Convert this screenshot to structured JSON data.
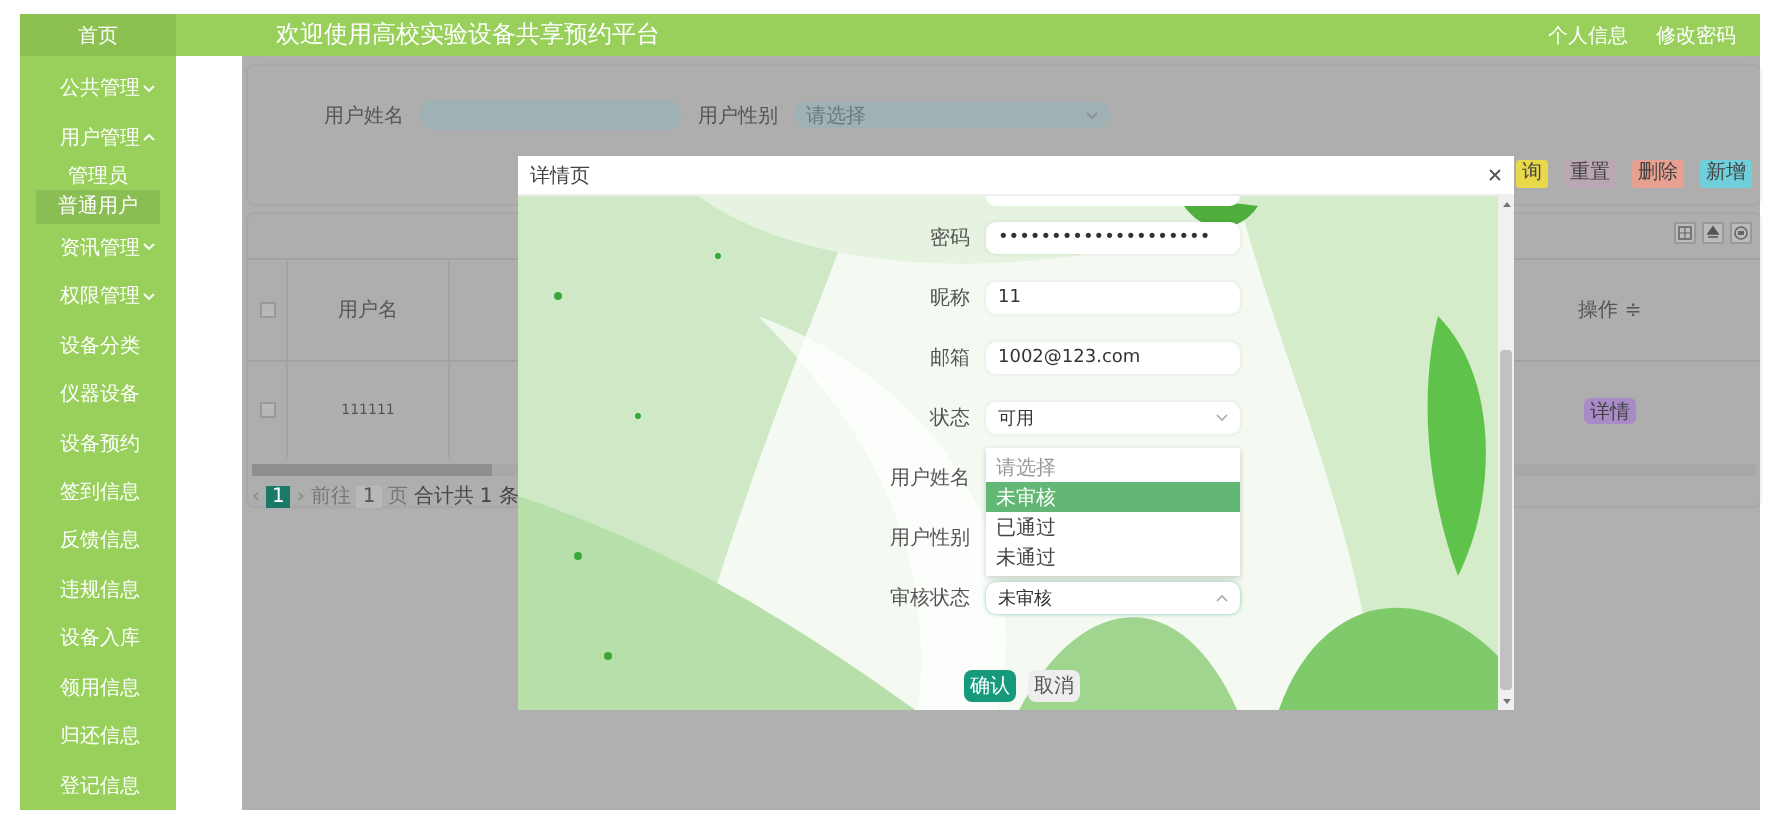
{
  "header": {
    "home": "首页",
    "title": "欢迎使用高校实验设备共享预约平台",
    "links": [
      "个人信息",
      "修改密码"
    ]
  },
  "sidebar": {
    "items": [
      {
        "label": "公共管理",
        "expanded": false
      },
      {
        "label": "用户管理",
        "expanded": true,
        "children": [
          {
            "label": "管理员",
            "selected": false
          },
          {
            "label": "普通用户",
            "selected": true
          }
        ]
      },
      {
        "label": "资讯管理",
        "expanded": false
      },
      {
        "label": "权限管理",
        "expanded": false
      },
      {
        "label": "设备分类"
      },
      {
        "label": "仪器设备"
      },
      {
        "label": "设备预约"
      },
      {
        "label": "签到信息"
      },
      {
        "label": "反馈信息"
      },
      {
        "label": "违规信息"
      },
      {
        "label": "设备入库"
      },
      {
        "label": "领用信息"
      },
      {
        "label": "归还信息"
      },
      {
        "label": "登记信息"
      }
    ]
  },
  "search": {
    "fields": [
      {
        "label": "用户姓名",
        "kind": "input"
      },
      {
        "label": "用户性别",
        "kind": "select",
        "placeholder": "请选择"
      }
    ],
    "buttons": [
      {
        "label": "询",
        "color": "#e8d84a"
      },
      {
        "label": "重置",
        "color": "#b9a7b3"
      },
      {
        "label": "删除",
        "color": "#e8a090"
      },
      {
        "label": "新增",
        "color": "#6fd0dc"
      }
    ]
  },
  "table": {
    "columns": [
      "用户名",
      "操作 ≑"
    ],
    "header_checked": false,
    "rows": [
      {
        "checked": false,
        "cells": [
          "111111"
        ],
        "action": "详情"
      }
    ]
  },
  "pagination": {
    "prev": "‹",
    "next": "›",
    "pages": [
      {
        "label": "1",
        "selected": true
      }
    ],
    "goto_label": "前往",
    "goto_value": "1",
    "page_unit": "页",
    "total": "合计共 1 条"
  },
  "dialog": {
    "title": "详情页",
    "fields": [
      {
        "label": "密码",
        "kind": "input",
        "value": "••••••••••••••••••••"
      },
      {
        "label": "昵称",
        "kind": "input",
        "value": "11"
      },
      {
        "label": "邮箱",
        "kind": "input",
        "value": "1002@123.com"
      },
      {
        "label": "状态",
        "kind": "select",
        "value": "可用",
        "open": false
      },
      {
        "label": "用户姓名",
        "kind": "hidden"
      },
      {
        "label": "用户性别",
        "kind": "hidden"
      },
      {
        "label": "审核状态",
        "kind": "select",
        "value": "未审核",
        "open": true
      }
    ],
    "dropdown": [
      {
        "label": "请选择",
        "selected": false,
        "kind": "placeholder"
      },
      {
        "label": "未审核",
        "selected": true
      },
      {
        "label": "已通过",
        "selected": false
      },
      {
        "label": "未通过",
        "selected": false
      }
    ],
    "buttons": [
      {
        "label": "确认",
        "kind": "primary"
      },
      {
        "label": "取消",
        "kind": "secondary"
      }
    ]
  }
}
